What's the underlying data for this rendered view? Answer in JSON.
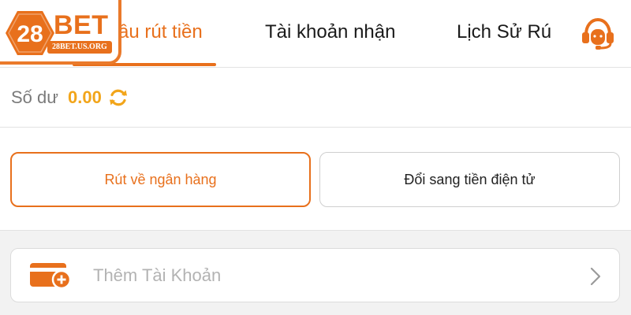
{
  "logo": {
    "number": "28",
    "word": "BET",
    "domain": "28BET.US.ORG"
  },
  "tabs": [
    {
      "label": "ầu rút tiền",
      "active": true
    },
    {
      "label": "Tài khoản nhận",
      "active": false
    },
    {
      "label": "Lịch Sử Rú",
      "active": false
    }
  ],
  "header": {
    "support_icon": "headset-icon"
  },
  "balance": {
    "label": "Số dư",
    "value": "0.00",
    "refresh_icon": "refresh-icon"
  },
  "options": [
    {
      "label": "Rút về ngân hàng",
      "selected": true
    },
    {
      "label": "Đổi sang tiền điện tử",
      "selected": false
    }
  ],
  "add_account": {
    "label": "Thêm Tài Khoản",
    "icon": "wallet-add-icon",
    "chevron_icon": "chevron-right-icon"
  },
  "colors": {
    "accent": "#e8701c",
    "balance": "#f2a51a",
    "muted": "#b3b3b3"
  }
}
